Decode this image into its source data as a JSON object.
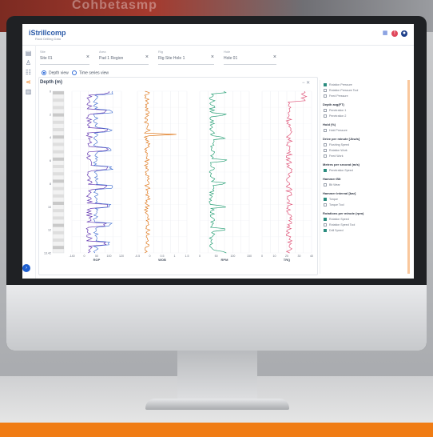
{
  "background": {
    "brand_text": "Cohbetasmp",
    "accent": "#f07c14"
  },
  "app": {
    "title": "iStrillcomp",
    "subtitle": "Rock Drilling Data",
    "brand_color": "#2b5aa8"
  },
  "top_icons": [
    "grid-icon",
    "alert-icon",
    "user-avatar-icon"
  ],
  "sidebar": {
    "items": [
      "grid-icon",
      "person-icon",
      "people-icon",
      "share-icon",
      "chart-icon"
    ]
  },
  "filters": [
    {
      "label": "Site",
      "value": "Site 01",
      "clear": "×"
    },
    {
      "label": "Area",
      "value": "Pad 1 Region",
      "clear": "×"
    },
    {
      "label": "Rig",
      "value": "Rig Site Hole 1",
      "clear": "×"
    },
    {
      "label": "Hole",
      "value": "Hole 01",
      "clear": "×"
    }
  ],
  "radios": [
    {
      "label": "Depth view",
      "selected": true
    },
    {
      "label": "Time series view",
      "selected": false
    }
  ],
  "plot": {
    "title": "Depth (m)",
    "tools": "− ✕",
    "depth_ticks": [
      "0",
      "2",
      "4",
      "6",
      "8",
      "10",
      "12",
      "13.42"
    ],
    "tracks": [
      {
        "ticks": [
          "-140",
          "0",
          "50",
          "100",
          "120"
        ],
        "label": "ROP",
        "color": "#6a3fb5"
      },
      {
        "ticks": [
          "-0.5",
          "0",
          "0.5",
          "1",
          "1.5"
        ],
        "label": "WOB",
        "color": "#e07a1f"
      },
      {
        "ticks": [
          "0",
          "50",
          "100",
          "150"
        ],
        "label": "RPM",
        "color": "#2fa37a"
      },
      {
        "ticks": [
          "0",
          "10",
          "20",
          "30",
          "40"
        ],
        "label": "TRQ",
        "color": "#e0567a"
      }
    ]
  },
  "legend": {
    "groups": [
      {
        "items": [
          {
            "label": "Rotation Pressure",
            "checked": true
          },
          {
            "label": "Rotation Pressure Tool",
            "checked": false
          },
          {
            "label": "Feed Pressure",
            "checked": false
          }
        ]
      },
      {
        "title": "Depth avg(FT)",
        "items": [
          {
            "label": "Penetration 1",
            "checked": false
          },
          {
            "label": "Penetration 2",
            "checked": false
          }
        ]
      },
      {
        "title": "Hold (%)",
        "items": [
          {
            "label": "Hold Pressure",
            "checked": false
          }
        ]
      },
      {
        "title": "Drive per minute [Jkw/s]",
        "items": [
          {
            "label": "Flushing Speed",
            "checked": false
          },
          {
            "label": "Rotation Work",
            "checked": false
          },
          {
            "label": "Feed Work",
            "checked": false
          }
        ]
      },
      {
        "title": "Metres per second (m/s)",
        "items": [
          {
            "label": "Penetration Speed",
            "checked": true
          }
        ]
      },
      {
        "title": "Hammer Bit",
        "items": [
          {
            "label": "Bit Wear",
            "checked": false
          }
        ]
      },
      {
        "title": "Hammer interval [bar]",
        "items": [
          {
            "label": "Torque",
            "checked": true
          },
          {
            "label": "Torque Tool",
            "checked": false
          }
        ]
      },
      {
        "title": "Rotations per minute (rpm)",
        "items": [
          {
            "label": "Rotation Speed",
            "checked": true
          },
          {
            "label": "Rotation Speed Tool",
            "checked": false
          },
          {
            "label": "Drill Speed",
            "checked": true
          }
        ]
      }
    ]
  }
}
